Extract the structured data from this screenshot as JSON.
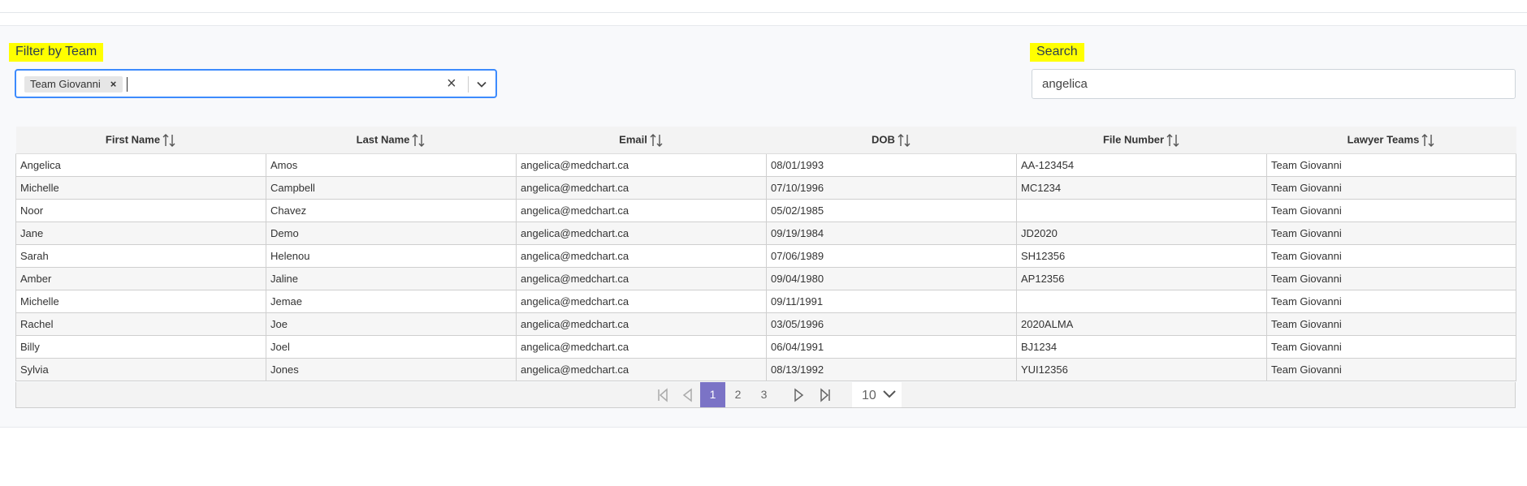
{
  "filter": {
    "label": "Filter by Team",
    "selected_chip": "Team Giovanni",
    "chip_remove": "×",
    "clear_all": "×"
  },
  "search": {
    "label": "Search",
    "value": "angelica"
  },
  "table": {
    "columns": [
      "First Name",
      "Last Name",
      "Email",
      "DOB",
      "File Number",
      "Lawyer Teams"
    ],
    "rows": [
      [
        "Angelica",
        "Amos",
        "angelica@medchart.ca",
        "08/01/1993",
        "AA-123454",
        "Team Giovanni"
      ],
      [
        "Michelle",
        "Campbell",
        "angelica@medchart.ca",
        "07/10/1996",
        "MC1234",
        "Team Giovanni"
      ],
      [
        "Noor",
        "Chavez",
        "angelica@medchart.ca",
        "05/02/1985",
        "",
        "Team Giovanni"
      ],
      [
        "Jane",
        "Demo",
        "angelica@medchart.ca",
        "09/19/1984",
        "JD2020",
        "Team Giovanni"
      ],
      [
        "Sarah",
        "Helenou",
        "angelica@medchart.ca",
        "07/06/1989",
        "SH12356",
        "Team Giovanni"
      ],
      [
        "Amber",
        "Jaline",
        "angelica@medchart.ca",
        "09/04/1980",
        "AP12356",
        "Team Giovanni"
      ],
      [
        "Michelle",
        "Jemae",
        "angelica@medchart.ca",
        "09/11/1991",
        "",
        "Team Giovanni"
      ],
      [
        "Rachel",
        "Joe",
        "angelica@medchart.ca",
        "03/05/1996",
        "2020ALMA",
        "Team Giovanni"
      ],
      [
        "Billy",
        "Joel",
        "angelica@medchart.ca",
        "06/04/1991",
        "BJ1234",
        "Team Giovanni"
      ],
      [
        "Sylvia",
        "Jones",
        "angelica@medchart.ca",
        "08/13/1992",
        "YUI12356",
        "Team Giovanni"
      ]
    ]
  },
  "pager": {
    "pages": [
      "1",
      "2",
      "3"
    ],
    "current_page": "1",
    "page_size": "10"
  },
  "colors": {
    "highlight": "#ffff00",
    "focus_border": "#3d8bfd",
    "active_page": "#7b73c6"
  },
  "icons": [
    "clear-icon",
    "chevron-down-icon",
    "sort-icon",
    "first-page-icon",
    "prev-page-icon",
    "next-page-icon",
    "last-page-icon"
  ]
}
